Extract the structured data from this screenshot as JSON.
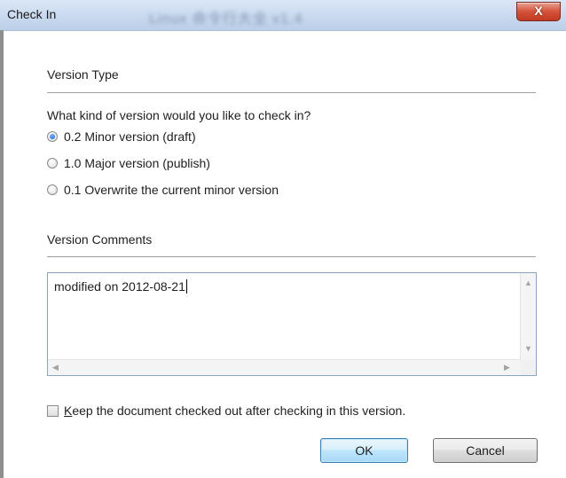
{
  "window": {
    "title": "Check In",
    "background_title": "Linux 命令行大全 v1.4",
    "close_label": "X"
  },
  "version_type": {
    "heading": "Version Type",
    "question": "What kind of version would you like to check in?",
    "options": [
      {
        "label": "0.2 Minor version (draft)",
        "selected": true
      },
      {
        "label": "1.0 Major version (publish)",
        "selected": false
      },
      {
        "label": "0.1 Overwrite the current minor version",
        "selected": false
      }
    ]
  },
  "version_comments": {
    "heading": "Version Comments",
    "value": "modified on 2012-08-21"
  },
  "keep_checked_out": {
    "access_key": "K",
    "label_rest": "eep the document checked out after checking in this version.",
    "checked": false
  },
  "buttons": {
    "ok": "OK",
    "cancel": "Cancel"
  },
  "colors": {
    "titlebar": "#c7d8ee",
    "close_button": "#c9462d",
    "accent": "#3c7fb1"
  }
}
